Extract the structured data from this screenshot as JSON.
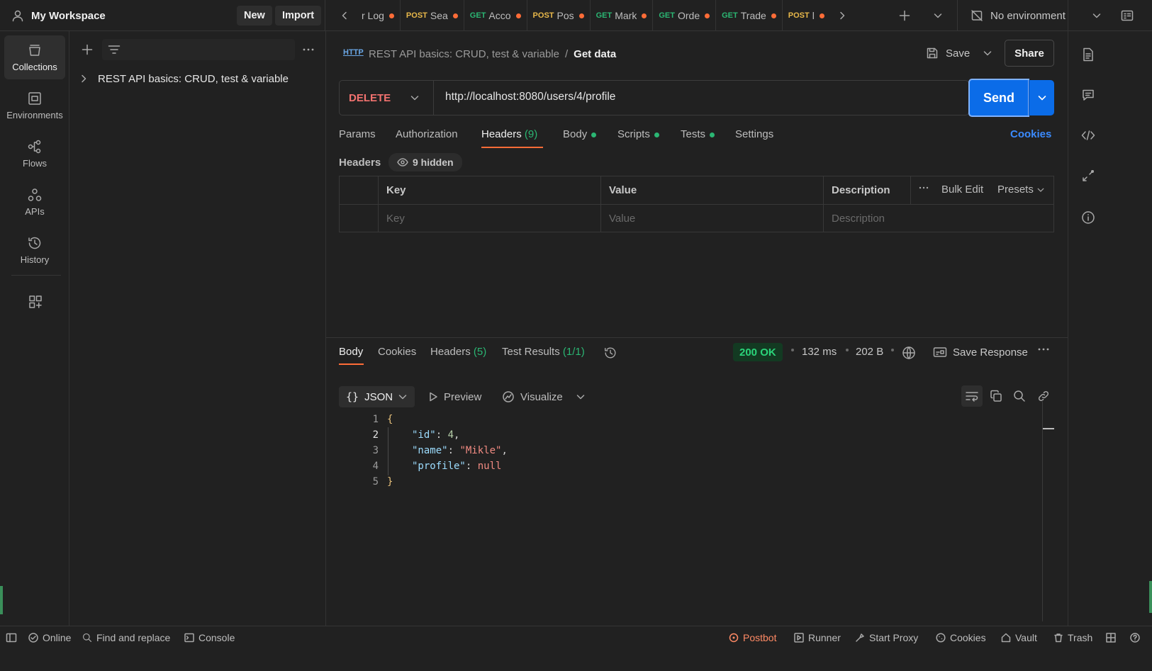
{
  "workspace": {
    "name": "My Workspace",
    "new_label": "New",
    "import_label": "Import"
  },
  "tabs": [
    {
      "method": "",
      "name": "r Log",
      "color": "#c8c8c8"
    },
    {
      "method": "POST",
      "name": "Sea",
      "color": "#e8b84a"
    },
    {
      "method": "GET",
      "name": "Acco",
      "color": "#2bb673"
    },
    {
      "method": "POST",
      "name": "Pos",
      "color": "#e8b84a"
    },
    {
      "method": "GET",
      "name": "Mark",
      "color": "#2bb673"
    },
    {
      "method": "GET",
      "name": "Orde",
      "color": "#2bb673"
    },
    {
      "method": "GET",
      "name": "Trade",
      "color": "#2bb673"
    },
    {
      "method": "POST",
      "name": "l",
      "color": "#e8b84a"
    }
  ],
  "environment": {
    "label": "No environment"
  },
  "rail": {
    "collections": "Collections",
    "environments": "Environments",
    "flows": "Flows",
    "apis": "APIs",
    "history": "History"
  },
  "sidebar": {
    "collection": "REST API basics: CRUD, test & variable"
  },
  "request": {
    "breadcrumb_parent": "REST API basics: CRUD, test & variable",
    "breadcrumb_sep": "/",
    "name": "Get data",
    "save_label": "Save",
    "share_label": "Share",
    "method": "DELETE",
    "url": "http://localhost:8080/users/4/profile",
    "send_label": "Send"
  },
  "req_tabs": {
    "params": "Params",
    "authorization": "Authorization",
    "headers": "Headers",
    "headers_count": "(9)",
    "body": "Body",
    "scripts": "Scripts",
    "tests": "Tests",
    "settings": "Settings",
    "cookies": "Cookies"
  },
  "headers_section": {
    "title": "Headers",
    "hidden": "9 hidden",
    "col_key": "Key",
    "col_value": "Value",
    "col_description": "Description",
    "bulk_edit": "Bulk Edit",
    "presets": "Presets",
    "ph_key": "Key",
    "ph_value": "Value",
    "ph_description": "Description"
  },
  "response": {
    "tabs": {
      "body": "Body",
      "cookies": "Cookies",
      "headers": "Headers",
      "headers_count": "(5)",
      "tests": "Test Results",
      "tests_count": "(1/1)"
    },
    "status": "200 OK",
    "time": "132 ms",
    "size": "202 B",
    "save_response": "Save Response",
    "format": "JSON",
    "preview": "Preview",
    "visualize": "Visualize",
    "lines": [
      {
        "n": "1",
        "text": "{"
      },
      {
        "n": "2",
        "key": "\"id\"",
        "value": "4",
        "type": "num"
      },
      {
        "n": "3",
        "key": "\"name\"",
        "value": "\"Mikle\"",
        "type": "str"
      },
      {
        "n": "4",
        "key": "\"profile\"",
        "value": "null",
        "type": "null"
      },
      {
        "n": "5",
        "text": "}"
      }
    ]
  },
  "statusbar": {
    "online": "Online",
    "find_replace": "Find and replace",
    "console": "Console",
    "postbot": "Postbot",
    "runner": "Runner",
    "start_proxy": "Start Proxy",
    "cookies": "Cookies",
    "vault": "Vault",
    "trash": "Trash"
  },
  "colors": {
    "accent": "#0b6ce8",
    "method_delete": "#f2726f",
    "postbot": "#ff8a65",
    "status_ok_bg": "#133a22",
    "status_ok": "#2bd47a"
  }
}
